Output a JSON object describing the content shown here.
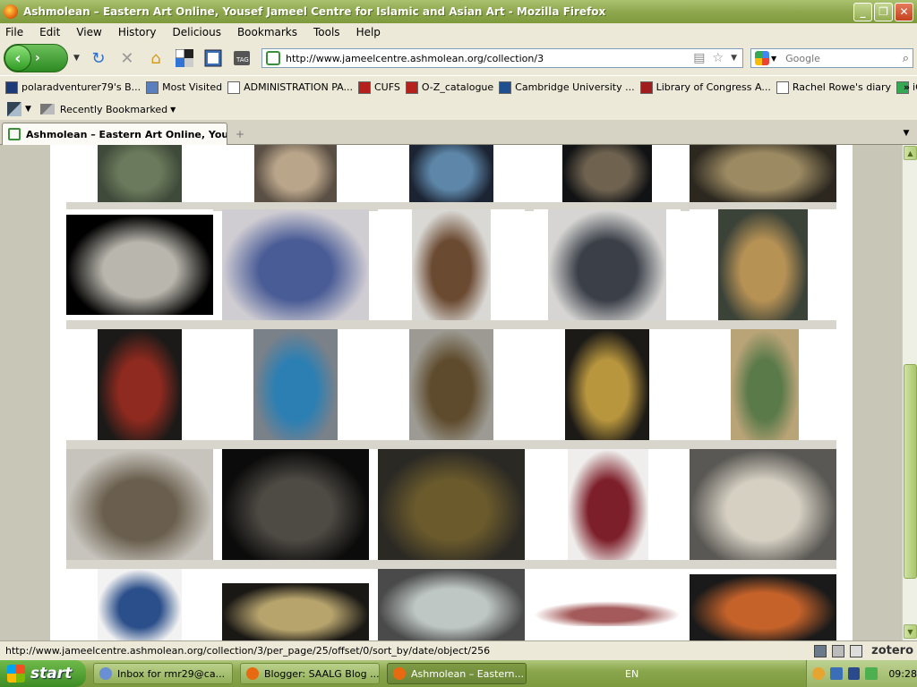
{
  "window": {
    "title": "Ashmolean – Eastern Art Online, Yousef Jameel Centre for Islamic and Asian Art - Mozilla Firefox",
    "minimize": "_",
    "maximize": "❐",
    "close": "✕"
  },
  "menu": [
    "File",
    "Edit",
    "View",
    "History",
    "Delicious",
    "Bookmarks",
    "Tools",
    "Help"
  ],
  "nav": {
    "url": "http://www.jameelcentre.ashmolean.org/collection/3",
    "search_placeholder": "Google"
  },
  "bookmarks": [
    {
      "label": "polaradventurer79's B...",
      "icon": "blue-square-icon",
      "color": "#1c3a78"
    },
    {
      "label": "Most Visited",
      "icon": "folder-icon",
      "color": "#5a7fbf"
    },
    {
      "label": "ADMINISTRATION PA...",
      "icon": "page-icon",
      "color": "#ffffff"
    },
    {
      "label": "CUFS",
      "icon": "crest-icon",
      "color": "#b5201d"
    },
    {
      "label": "O-Z_catalogue",
      "icon": "crest-icon",
      "color": "#b5201d"
    },
    {
      "label": "Cambridge University ...",
      "icon": "ul-icon",
      "color": "#1f4e91"
    },
    {
      "label": "Library of Congress A...",
      "icon": "library-icon",
      "color": "#a11d1d"
    },
    {
      "label": "Rachel Rowe's diary",
      "icon": "page-icon",
      "color": "#ffffff"
    },
    {
      "label": "iGoogle",
      "icon": "google-icon",
      "color": "#34a853"
    }
  ],
  "bookmarks_more": "»",
  "bookmarks2": {
    "recently_bookmarked": "Recently Bookmarked"
  },
  "tab": {
    "label": "Ashmolean – Eastern Art Online, You...",
    "new_tab": "+"
  },
  "status": {
    "url": "http://www.jameelcentre.ashmolean.org/collection/3/per_page/25/offset/0/sort_by/date/object/256",
    "addon": "zotero"
  },
  "taskbar": {
    "start": "start",
    "tasks": [
      {
        "label": "Inbox for rmr29@ca...",
        "color": "#6a8fd4"
      },
      {
        "label": "Blogger: SAALG Blog ...",
        "color": "#e86a10"
      },
      {
        "label": "Ashmolean – Eastern...",
        "color": "#e86a10"
      }
    ],
    "language": "EN",
    "clock": "09:28"
  },
  "gallery": {
    "rows": [
      [
        {
          "name": "bronze-vessel-on-stand",
          "bg": "#3f4a3a",
          "fg": "#6b7a5c"
        },
        {
          "name": "ceramic-figure",
          "bg": "#5a4f44",
          "fg": "#b9a58a"
        },
        {
          "name": "blue-glass-vessel",
          "bg": "#1c2433",
          "fg": "#5d86a8"
        },
        {
          "name": "standing-bronze-figure",
          "bg": "#111214",
          "fg": "#6f6350"
        },
        {
          "name": "carved-ivory-disc",
          "bg": "#2c2820",
          "fg": "#9c8a62"
        }
      ],
      [
        {
          "name": "carved-stone-inscription",
          "bg": "#000000",
          "fg": "#b9b6ad"
        },
        {
          "name": "blue-calligraphy-tile",
          "bg": "#cfccd2",
          "fg": "#4a5c96"
        },
        {
          "name": "lacquer-panel-pair",
          "bg": "#d9d8d4",
          "fg": "#6b4a32"
        },
        {
          "name": "blue-white-plate",
          "bg": "#d6d5d3",
          "fg": "#3a3f48"
        },
        {
          "name": "enamelled-glass-lamp",
          "bg": "#3b4238",
          "fg": "#b79255"
        }
      ],
      [
        {
          "name": "mandala-textile",
          "bg": "#1c1a18",
          "fg": "#8e2a1f"
        },
        {
          "name": "turquoise-ewer",
          "bg": "#7b8189",
          "fg": "#2c7fb3"
        },
        {
          "name": "bronze-ganesha",
          "bg": "#9c9a92",
          "fg": "#5e4a2c"
        },
        {
          "name": "brass-candlestick",
          "bg": "#1c1a17",
          "fg": "#b8963e"
        },
        {
          "name": "miniature-painting",
          "bg": "#b9a478",
          "fg": "#5b7a4a"
        }
      ],
      [
        {
          "name": "inlaid-casket",
          "bg": "#c7c4bd",
          "fg": "#6a5f4e"
        },
        {
          "name": "stone-nandi-bull",
          "bg": "#0b0b0b",
          "fg": "#4e4a44"
        },
        {
          "name": "painted-lacquer-box",
          "bg": "#2b2924",
          "fg": "#6a5a2c"
        },
        {
          "name": "red-carpet",
          "bg": "#efeeec",
          "fg": "#7d1f2a"
        },
        {
          "name": "ivory-cabinet",
          "bg": "#5a5854",
          "fg": "#d6d0c3"
        }
      ],
      [
        {
          "name": "blue-white-vase",
          "bg": "#f2f2f2",
          "fg": "#2b4f8a"
        },
        {
          "name": "painted-folding-screen",
          "bg": "#1a1815",
          "fg": "#b7a46d"
        },
        {
          "name": "jade-object",
          "bg": "#4a4a4a",
          "fg": "#bfc7c4"
        },
        {
          "name": "red-striped-robe",
          "bg": "#ffffff",
          "fg": "#a45a5a"
        },
        {
          "name": "embroidered-coat",
          "bg": "#1a1a1a",
          "fg": "#c4622a"
        }
      ]
    ]
  }
}
